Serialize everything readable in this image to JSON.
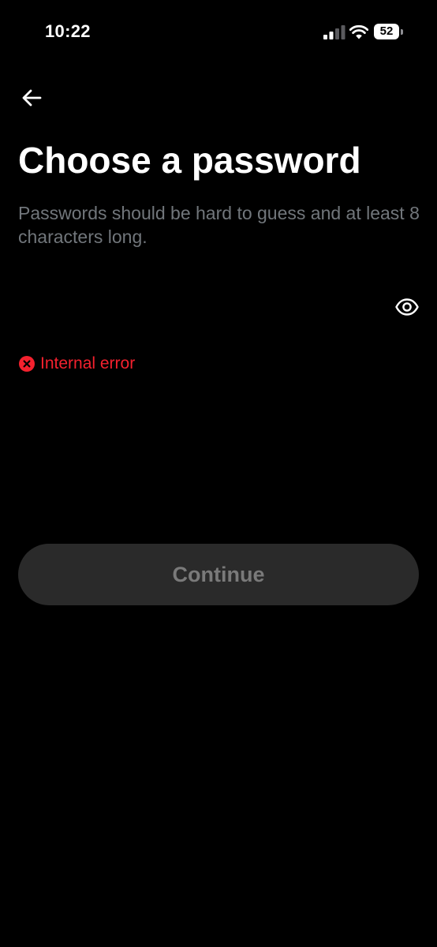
{
  "status_bar": {
    "time": "10:22",
    "battery_level": "52",
    "signal_icon": "cellular-signal-icon",
    "wifi_icon": "wifi-icon"
  },
  "navigation": {
    "back_icon": "arrow-left-icon"
  },
  "header": {
    "title": "Choose a password",
    "subtitle": "Passwords should be hard to guess and at least 8 characters long."
  },
  "password": {
    "value": "",
    "placeholder": "",
    "toggle_icon": "eye-icon"
  },
  "error": {
    "icon": "error-x-icon",
    "message": "Internal error",
    "color": "#f4212e"
  },
  "actions": {
    "continue_label": "Continue",
    "continue_enabled": false
  },
  "colors": {
    "background": "#000000",
    "text_primary": "#ffffff",
    "text_secondary": "#71767b",
    "button_disabled_bg": "#2a2a2a",
    "button_disabled_text": "#7a7a7a"
  }
}
